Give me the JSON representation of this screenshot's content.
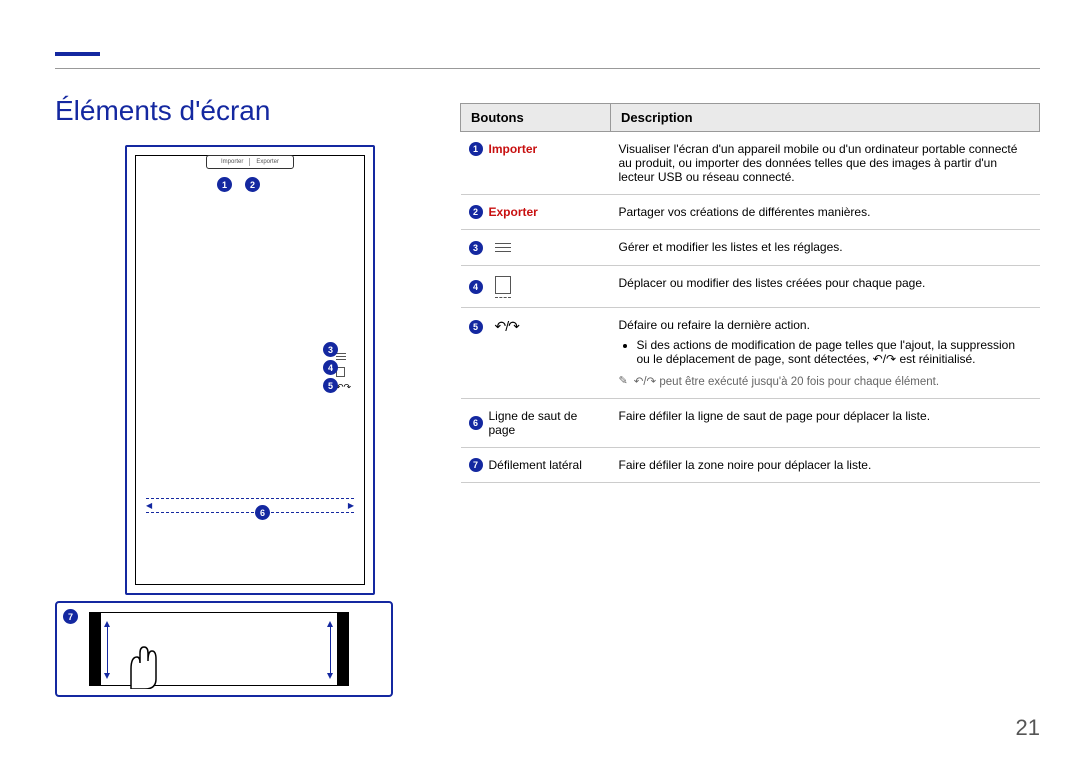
{
  "page": {
    "number": "21"
  },
  "title": "Éléments d'écran",
  "table": {
    "head_buttons": "Boutons",
    "head_description": "Description"
  },
  "diagram": {
    "top_import": "Importer",
    "top_export": "Exporter",
    "callout1": "1",
    "callout2": "2",
    "callout3": "3",
    "callout4": "4",
    "callout5": "5",
    "callout6": "6",
    "callout7": "7"
  },
  "rows": {
    "r1": {
      "num": "1",
      "label": "Importer",
      "desc": "Visualiser l'écran d'un appareil mobile ou d'un ordinateur portable connecté au produit, ou importer des données telles que des images à partir d'un lecteur USB ou réseau connecté."
    },
    "r2": {
      "num": "2",
      "label": "Exporter",
      "desc": "Partager vos créations de différentes manières."
    },
    "r3": {
      "num": "3",
      "desc": "Gérer et modifier les listes et les réglages."
    },
    "r4": {
      "num": "4",
      "desc": "Déplacer ou modifier des listes créées pour chaque page."
    },
    "r5": {
      "num": "5",
      "undo_redo_glyph": "↶/↷",
      "line1": "Défaire ou refaire la dernière action.",
      "bullet_pre": "Si des actions de modification de page telles que l'ajout, la suppression ou le déplacement de page, sont détectées, ",
      "bullet_mid": "↶/↷",
      "bullet_post": " est réinitialisé.",
      "note_icon": "✎",
      "note_glyph": "↶/↷",
      "note_text": " peut être exécuté jusqu'à 20 fois pour chaque élément."
    },
    "r6": {
      "num": "6",
      "label": "Ligne de saut de page",
      "desc": "Faire défiler la ligne de saut de page pour déplacer la liste."
    },
    "r7": {
      "num": "7",
      "label": "Défilement latéral",
      "desc": "Faire défiler la zone noire pour déplacer la liste."
    }
  }
}
